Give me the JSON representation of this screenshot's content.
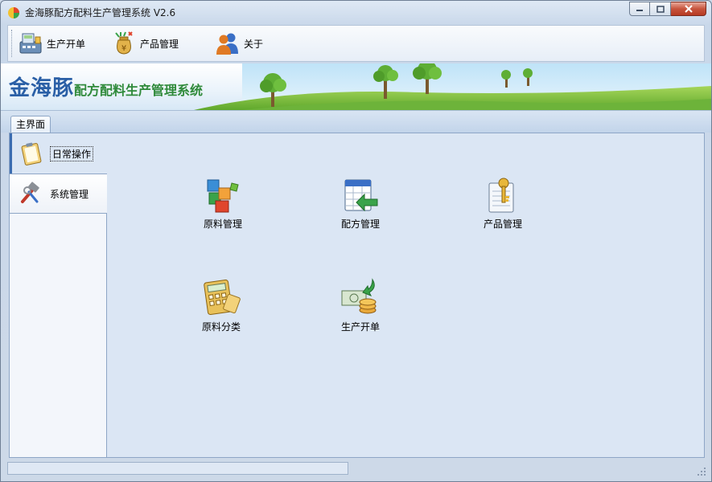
{
  "window": {
    "title": "金海豚配方配料生产管理系统 V2.6",
    "app_icon": "pie-chart-icon",
    "controls": [
      "minimize",
      "maximize",
      "close"
    ]
  },
  "toolbar": {
    "items": [
      {
        "label": "生产开单",
        "icon": "cash-register-icon"
      },
      {
        "label": "产品管理",
        "icon": "money-bag-icon"
      },
      {
        "label": "关于",
        "icon": "users-icon"
      }
    ]
  },
  "banner": {
    "title_main": "金海豚",
    "title_sub": "配方配料生产管理系统"
  },
  "tabs": [
    {
      "label": "主界面",
      "active": true
    }
  ],
  "sidebar": {
    "items": [
      {
        "label": "日常操作",
        "icon": "clipboard-icon",
        "active": true
      },
      {
        "label": "系统管理",
        "icon": "tools-icon",
        "active": false
      }
    ]
  },
  "functions": [
    {
      "label": "原料管理",
      "icon": "blocks-icon"
    },
    {
      "label": "配方管理",
      "icon": "calendar-arrow-icon"
    },
    {
      "label": "产品管理",
      "icon": "key-document-icon"
    },
    {
      "label": "原料分类",
      "icon": "calculator-icon"
    },
    {
      "label": "生产开单",
      "icon": "banknote-coins-icon"
    }
  ],
  "colors": {
    "title_blue": "#2a5fa6",
    "title_green": "#2f8a3a",
    "panel_bg": "#dbe6f4",
    "close_red": "#c7543d"
  }
}
